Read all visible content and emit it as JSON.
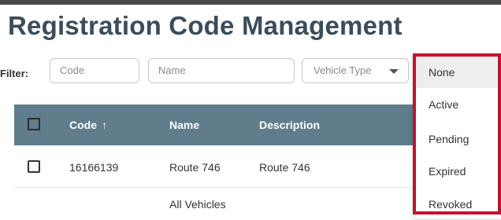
{
  "page": {
    "title": "Registration Code Management"
  },
  "filter": {
    "label": "Filter:",
    "code_placeholder": "Code",
    "name_placeholder": "Name",
    "vehicle_type_placeholder": "Vehicle Type"
  },
  "table": {
    "columns": [
      "Code",
      "Name",
      "Description"
    ],
    "sort_indicator": "↑",
    "rows": [
      {
        "code": "16166139",
        "name": "Route 746",
        "description": "Route 746"
      },
      {
        "name": "All Vehicles"
      }
    ]
  },
  "status_dropdown": {
    "options": [
      "None",
      "Active",
      "Pending",
      "Expired",
      "Revoked"
    ],
    "selected": "None"
  },
  "colors": {
    "header_bg": "#607d8b",
    "title": "#3b4d5a",
    "highlight_border": "#c8102e"
  }
}
